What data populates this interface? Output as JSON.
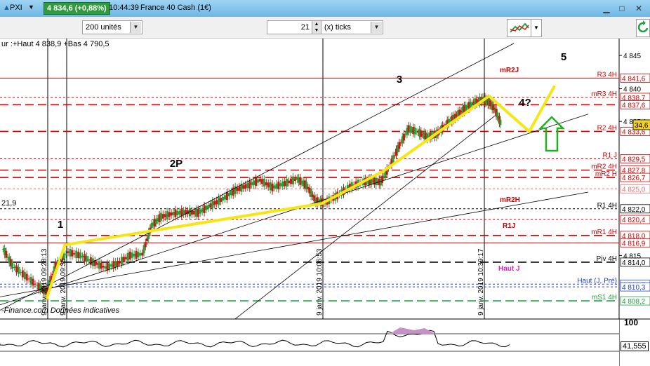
{
  "window": {
    "instrument": "PXI",
    "price": "4 834,6 (+0,88%)",
    "time": "10:44:39",
    "name": "France 40 Cash (1€)"
  },
  "toolbar": {
    "units": "200 unités",
    "ticks_value": "21",
    "ticks_label": "(x) ticks"
  },
  "header_text": "ur :+Haut 4 838,9 +Bas 4 790,5",
  "source_text": "-Finance.com Données indicatives",
  "left_label": "21,9",
  "indicator": {
    "top_label": "100",
    "value": "41,555"
  },
  "chart_data": {
    "type": "candlestick",
    "ylim": [
      4806,
      4847
    ],
    "y_ticks": [
      "4 845",
      "4 840",
      "4 835,1",
      "4 815"
    ],
    "current_price_label": "34,6",
    "levels": [
      {
        "name": "R3 4H",
        "value": "4 841,6",
        "color": "#d00000",
        "style": "solid"
      },
      {
        "name": "mR2J",
        "value": "",
        "color": "#d00000",
        "style": "label"
      },
      {
        "name": "mR3 4H",
        "value": "4 838,7",
        "color": "#d00000",
        "style": "dotted"
      },
      {
        "name": "",
        "value": "4 837,6",
        "color": "#d00000",
        "style": "dashed"
      },
      {
        "name": "R2 4H",
        "value": "4 833,6",
        "color": "#d00000",
        "style": "dashed"
      },
      {
        "name": "R1 J",
        "value": "4 829,5",
        "color": "#d00000",
        "style": "dotted"
      },
      {
        "name": "mR2 4H",
        "value": "4 827,8",
        "color": "#d00000",
        "style": "dashed"
      },
      {
        "name": "mR2 H",
        "value": "4 826,7",
        "color": "#d00000",
        "style": "dashed"
      },
      {
        "name": "",
        "value": "4 825,0",
        "color": "#e07070",
        "style": "dotted"
      },
      {
        "name": "R1 4H",
        "value": "4 822,0",
        "color": "#000000",
        "style": "dotted"
      },
      {
        "name": "mR2H",
        "value": "",
        "color": "#d00000",
        "style": "label"
      },
      {
        "name": "",
        "value": "4 820,4",
        "color": "#d00000",
        "style": "dotted"
      },
      {
        "name": "mR1 4H",
        "value": "4 818,0",
        "color": "#d00000",
        "style": "dashed"
      },
      {
        "name": "R1J",
        "value": "",
        "color": "#d00000",
        "style": "label"
      },
      {
        "name": "",
        "value": "4 816,9",
        "color": "#d00000",
        "style": "solid"
      },
      {
        "name": "Piv 4H",
        "value": "4 814,0",
        "color": "#000000",
        "style": "dashed"
      },
      {
        "name": "Haut J",
        "value": "",
        "color": "#e020c0",
        "style": "label"
      },
      {
        "name": "Haut (J, Pré)",
        "value": "4 810,7",
        "color": "#2040c0",
        "style": "dotted"
      },
      {
        "name": "",
        "value": "4 810,3",
        "color": "#2040c0",
        "style": "dotted"
      },
      {
        "name": "mS1 4H",
        "value": "4 808,2",
        "color": "#20a040",
        "style": "dashed"
      }
    ],
    "time_labels": [
      "9 janv. 2019 09:28:13",
      "9 janv. 2019 09:35",
      "9 janv. 2019 10:06:53",
      "9 janv. 2019 10:39:17"
    ],
    "wave_labels": [
      "1",
      "2P",
      "3",
      "4?",
      "5"
    ],
    "wave_path": [
      {
        "t": 0.075,
        "v": 4808.5
      },
      {
        "t": 0.105,
        "v": 4816.6
      },
      {
        "t": 0.52,
        "v": 4822.8
      },
      {
        "t": 0.62,
        "v": 4827.7
      },
      {
        "t": 0.79,
        "v": 4838.9
      },
      {
        "t": 0.855,
        "v": 4833.6
      },
      {
        "t": 0.895,
        "v": 4840.3
      }
    ],
    "candles": [
      {
        "t": 0.005,
        "v": 4816.0
      },
      {
        "t": 0.02,
        "v": 4813.5
      },
      {
        "t": 0.04,
        "v": 4812.0
      },
      {
        "t": 0.06,
        "v": 4810.5
      },
      {
        "t": 0.075,
        "v": 4809.5
      },
      {
        "t": 0.09,
        "v": 4813.5
      },
      {
        "t": 0.11,
        "v": 4815.5
      },
      {
        "t": 0.13,
        "v": 4815.0
      },
      {
        "t": 0.15,
        "v": 4814.0
      },
      {
        "t": 0.17,
        "v": 4813.2
      },
      {
        "t": 0.19,
        "v": 4813.8
      },
      {
        "t": 0.21,
        "v": 4815.0
      },
      {
        "t": 0.23,
        "v": 4815.2
      },
      {
        "t": 0.245,
        "v": 4819.5
      },
      {
        "t": 0.26,
        "v": 4820.8
      },
      {
        "t": 0.28,
        "v": 4821.3
      },
      {
        "t": 0.3,
        "v": 4821.5
      },
      {
        "t": 0.32,
        "v": 4821.4
      },
      {
        "t": 0.34,
        "v": 4822.5
      },
      {
        "t": 0.36,
        "v": 4823.5
      },
      {
        "t": 0.38,
        "v": 4824.8
      },
      {
        "t": 0.4,
        "v": 4825.5
      },
      {
        "t": 0.42,
        "v": 4826.3
      },
      {
        "t": 0.44,
        "v": 4825.2
      },
      {
        "t": 0.46,
        "v": 4825.8
      },
      {
        "t": 0.48,
        "v": 4826.5
      },
      {
        "t": 0.495,
        "v": 4825.5
      },
      {
        "t": 0.51,
        "v": 4823.2
      },
      {
        "t": 0.525,
        "v": 4822.9
      },
      {
        "t": 0.545,
        "v": 4824.0
      },
      {
        "t": 0.565,
        "v": 4825.3
      },
      {
        "t": 0.585,
        "v": 4826.0
      },
      {
        "t": 0.6,
        "v": 4826.2
      },
      {
        "t": 0.615,
        "v": 4826.0
      },
      {
        "t": 0.63,
        "v": 4828.5
      },
      {
        "t": 0.645,
        "v": 4831.5
      },
      {
        "t": 0.66,
        "v": 4834.0
      },
      {
        "t": 0.675,
        "v": 4833.5
      },
      {
        "t": 0.69,
        "v": 4832.8
      },
      {
        "t": 0.705,
        "v": 4833.2
      },
      {
        "t": 0.72,
        "v": 4834.6
      },
      {
        "t": 0.735,
        "v": 4835.8
      },
      {
        "t": 0.75,
        "v": 4837.0
      },
      {
        "t": 0.765,
        "v": 4837.9
      },
      {
        "t": 0.78,
        "v": 4838.4
      },
      {
        "t": 0.79,
        "v": 4838.0
      },
      {
        "t": 0.8,
        "v": 4836.8
      },
      {
        "t": 0.81,
        "v": 4834.6
      }
    ]
  }
}
